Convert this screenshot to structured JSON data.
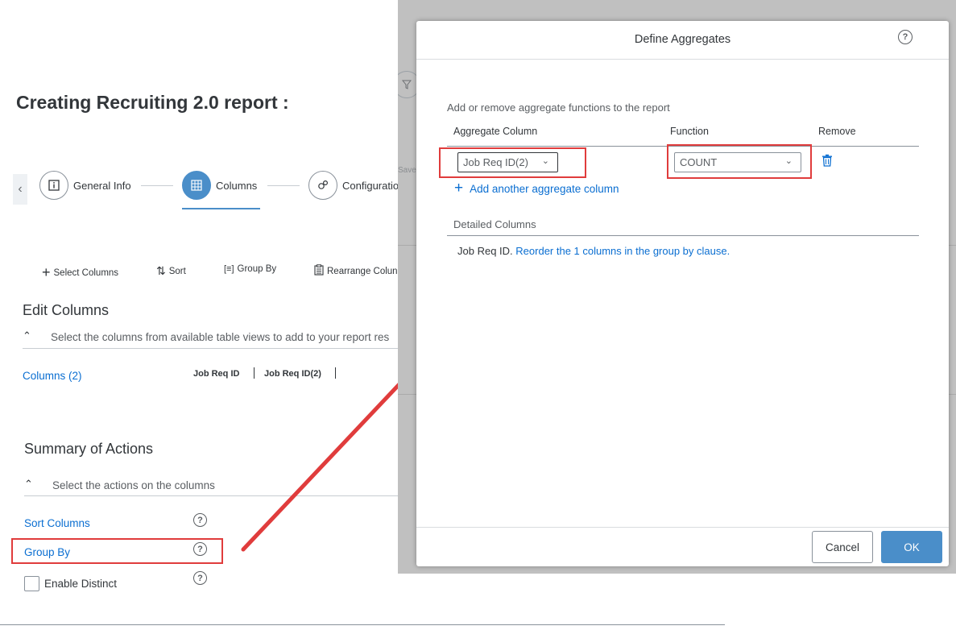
{
  "page": {
    "title": "Creating Recruiting 2.0 report :"
  },
  "steps": [
    {
      "label": "General Info",
      "icon": "info-icon"
    },
    {
      "label": "Columns",
      "icon": "table-icon",
      "active": true
    },
    {
      "label": "Configuratio",
      "icon": "gear-icon"
    }
  ],
  "overlay_hint": "Save",
  "toolbar": {
    "select_columns": "Select Columns",
    "sort": "Sort",
    "group_by": "Group By",
    "rearrange": "Rearrange Colun"
  },
  "edit_columns": {
    "title": "Edit Columns",
    "hint": "Select the columns from available table views to add to your report res",
    "columns_link": "Columns (2)",
    "tokens": [
      "Job Req ID",
      "Job Req ID(2)"
    ]
  },
  "summary": {
    "title": "Summary of Actions",
    "hint": "Select the actions on the columns",
    "sort_columns": "Sort Columns",
    "group_by": "Group By",
    "enable_distinct": "Enable Distinct",
    "help_glyph": "?"
  },
  "dialog": {
    "title": "Define Aggregates",
    "help_glyph": "?",
    "intro": "Add or remove aggregate functions to the report",
    "headers": {
      "aggregate_column": "Aggregate Column",
      "function": "Function",
      "remove": "Remove"
    },
    "row": {
      "aggregate_value": "Job Req ID(2)",
      "function_value": "COUNT"
    },
    "add_link": "Add another aggregate column",
    "detailed_title": "Detailed Columns",
    "detailed_prefix": "Job Req ID.",
    "detailed_link": "Reorder the 1 columns in the group by clause.",
    "cancel": "Cancel",
    "ok": "OK"
  },
  "colors": {
    "accent": "#0a6ed1",
    "primary_button": "#4a8ec9",
    "highlight": "#e03c3c"
  }
}
